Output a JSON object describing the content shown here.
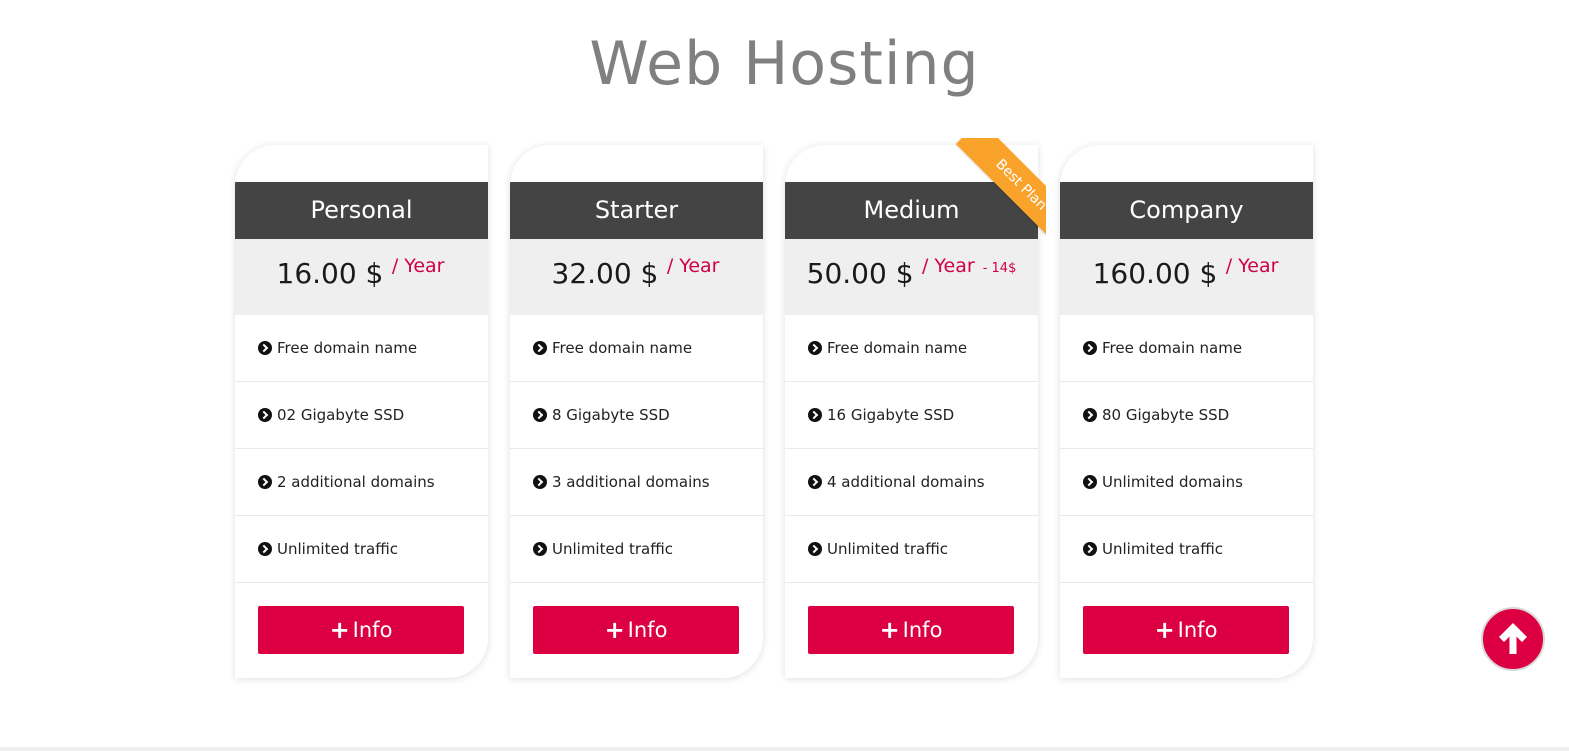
{
  "page": {
    "title": "Web Hosting"
  },
  "plans": [
    {
      "name": "Personal",
      "price": "16.00 $",
      "period": "/ Year",
      "discount": "",
      "features": [
        "Free domain name",
        "02 Gigabyte SSD",
        "2 additional domains",
        "Unlimited traffic"
      ],
      "button_label": "Info"
    },
    {
      "name": "Starter",
      "price": "32.00 $",
      "period": "/ Year",
      "discount": "",
      "features": [
        "Free domain name",
        "8 Gigabyte SSD",
        "3 additional domains",
        "Unlimited traffic"
      ],
      "button_label": "Info"
    },
    {
      "name": "Medium",
      "price": "50.00 $",
      "period": "/ Year",
      "discount": "- 14$",
      "ribbon": "Best Plan",
      "features": [
        "Free domain name",
        "16 Gigabyte SSD",
        "4 additional domains",
        "Unlimited traffic"
      ],
      "button_label": "Info"
    },
    {
      "name": "Company",
      "price": "160.00 $",
      "period": "/ Year",
      "discount": "",
      "features": [
        "Free domain name",
        "80 Gigabyte SSD",
        "Unlimited domains",
        "Unlimited traffic"
      ],
      "button_label": "Info"
    }
  ],
  "icons": {
    "feature_bullet": "chevron-circle-right-icon",
    "button_icon": "plus-icon",
    "scroll_top": "arrow-up-icon"
  },
  "colors": {
    "accent": "#dc0042",
    "header_bg": "#444444",
    "price_bg": "#efefef",
    "ribbon": "#f9a32b",
    "title": "#808080"
  }
}
